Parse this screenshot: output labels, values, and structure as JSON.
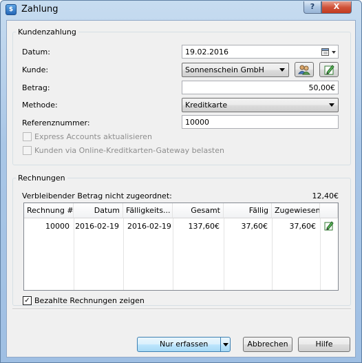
{
  "window": {
    "title": "Zahlung",
    "help_glyph": "?",
    "close_glyph": "X",
    "app_icon_glyph": "$"
  },
  "payment": {
    "legend": "Kundenzahlung",
    "date_label": "Datum:",
    "date_value": "19.02.2016",
    "customer_label": "Kunde:",
    "customer_value": "Sonnenschein GmbH",
    "amount_label": "Betrag:",
    "amount_value": "50,00€",
    "method_label": "Methode:",
    "method_value": "Kreditkarte",
    "reference_label": "Referenznummer:",
    "reference_value": "10000",
    "express_label": "Express Accounts aktualisieren",
    "gateway_label": "Kunden via Online-Kreditkarten-Gateway belasten",
    "express_checked": false,
    "gateway_checked": false
  },
  "invoices": {
    "legend": "Rechnungen",
    "unassigned_label": "Verbleibender Betrag nicht zugeordnet:",
    "unassigned_value": "12,40€",
    "columns": [
      "Rechnung #",
      "Datum",
      "Fälligkeits...",
      "Gesamt",
      "Fällig",
      "Zugewiesen"
    ],
    "rows": [
      {
        "number": "10000",
        "date": "2016-02-19",
        "due_date": "2016-02-19",
        "total": "137,60€",
        "due": "37,60€",
        "assigned": "37,60€"
      }
    ],
    "show_paid_label": "Bezahlte Rechnungen zeigen",
    "show_paid_checked": true
  },
  "buttons": {
    "record": "Nur erfassen",
    "cancel": "Abbrechen",
    "help": "Hilfe"
  },
  "icons": [
    "calendar-icon",
    "customers-icon",
    "edit-icon",
    "dropdown-arrow-icon",
    "checkmark-icon"
  ],
  "colors": {
    "title_gradient": "#a9c6e6",
    "close_red": "#c23a1f",
    "default_button": "#bee6fd"
  }
}
